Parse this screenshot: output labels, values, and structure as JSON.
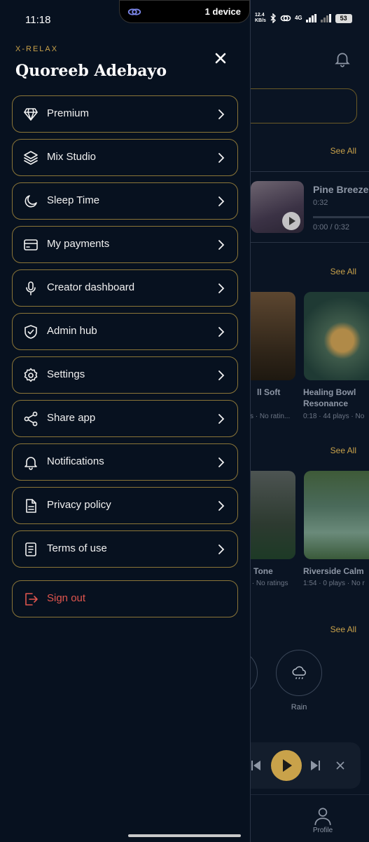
{
  "status_bar": {
    "time": "11:18",
    "pill_text": "1 device",
    "speed_value": "12.4",
    "speed_unit": "KB/s",
    "network": "4G",
    "battery": "53"
  },
  "drawer": {
    "brand": "X-RELAX",
    "user_name": "Quoreeb Adebayo",
    "items": [
      {
        "label": "Premium",
        "icon": "diamond-icon"
      },
      {
        "label": "Mix Studio",
        "icon": "layers-icon"
      },
      {
        "label": "Sleep Time",
        "icon": "moon-icon"
      },
      {
        "label": "My payments",
        "icon": "credit-card-icon"
      },
      {
        "label": "Creator dashboard",
        "icon": "microphone-icon"
      },
      {
        "label": "Admin hub",
        "icon": "shield-check-icon"
      },
      {
        "label": "Settings",
        "icon": "gear-icon"
      },
      {
        "label": "Share app",
        "icon": "share-icon"
      },
      {
        "label": "Notifications",
        "icon": "bell-icon"
      },
      {
        "label": "Privacy policy",
        "icon": "document-icon"
      },
      {
        "label": "Terms of use",
        "icon": "receipt-icon"
      }
    ],
    "signout": {
      "label": "Sign out",
      "icon": "logout-icon"
    }
  },
  "background": {
    "see_all": "See All",
    "now_playing": {
      "title": "Pine Breeze",
      "duration": "0:32",
      "time": "0:00 / 0:32",
      "progress": 0.0
    },
    "cards_row1": [
      {
        "title": "ll Soft",
        "meta": "ys · No ratin..."
      },
      {
        "title": "Healing Bowl Resonance",
        "meta": "0:18 · 44 plays · No"
      }
    ],
    "cards_row2": [
      {
        "title": "Tone",
        "meta": "s · No ratings"
      },
      {
        "title": "Riverside Calm",
        "meta": "1:54 · 0 plays · No r"
      }
    ],
    "category": {
      "label": "Rain"
    },
    "nav": {
      "profile": "Profile"
    }
  },
  "colors": {
    "accent": "#c9a24a",
    "danger": "#e0554e",
    "background": "#07111f"
  }
}
